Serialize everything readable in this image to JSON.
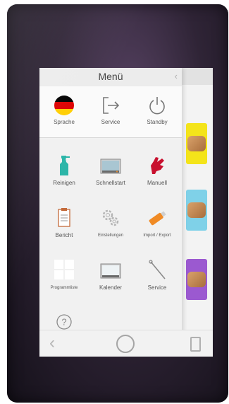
{
  "menu": {
    "title": "Menü",
    "top_items": [
      {
        "label": "Sprache",
        "icon": "german-flag-icon"
      },
      {
        "label": "Service",
        "icon": "exit-arrow-icon"
      },
      {
        "label": "Standby",
        "icon": "power-icon"
      }
    ],
    "grid_items": [
      {
        "label": "Reinigen",
        "icon": "cleaning-bottle-icon"
      },
      {
        "label": "Schnellstart",
        "icon": "oven-icon"
      },
      {
        "label": "Manuell",
        "icon": "hand-icon"
      },
      {
        "label": "Bericht",
        "icon": "clipboard-icon"
      },
      {
        "label": "Einstellungen",
        "icon": "gears-icon"
      },
      {
        "label": "Import / Export",
        "icon": "usb-stick-icon"
      },
      {
        "label": "Programmliste",
        "icon": "grid-icon"
      },
      {
        "label": "Kalender",
        "icon": "calendar-screen-icon"
      },
      {
        "label": "Service",
        "icon": "wrench-icon"
      }
    ],
    "help_icon": "help-icon"
  },
  "nav": {
    "back_glyph": "‹"
  },
  "colors": {
    "flag_black": "#000000",
    "flag_red": "#dd0000",
    "flag_gold": "#ffce00",
    "reinigen": "#2bb5a8",
    "manuell": "#c8102e",
    "usb": "#f08a24"
  }
}
